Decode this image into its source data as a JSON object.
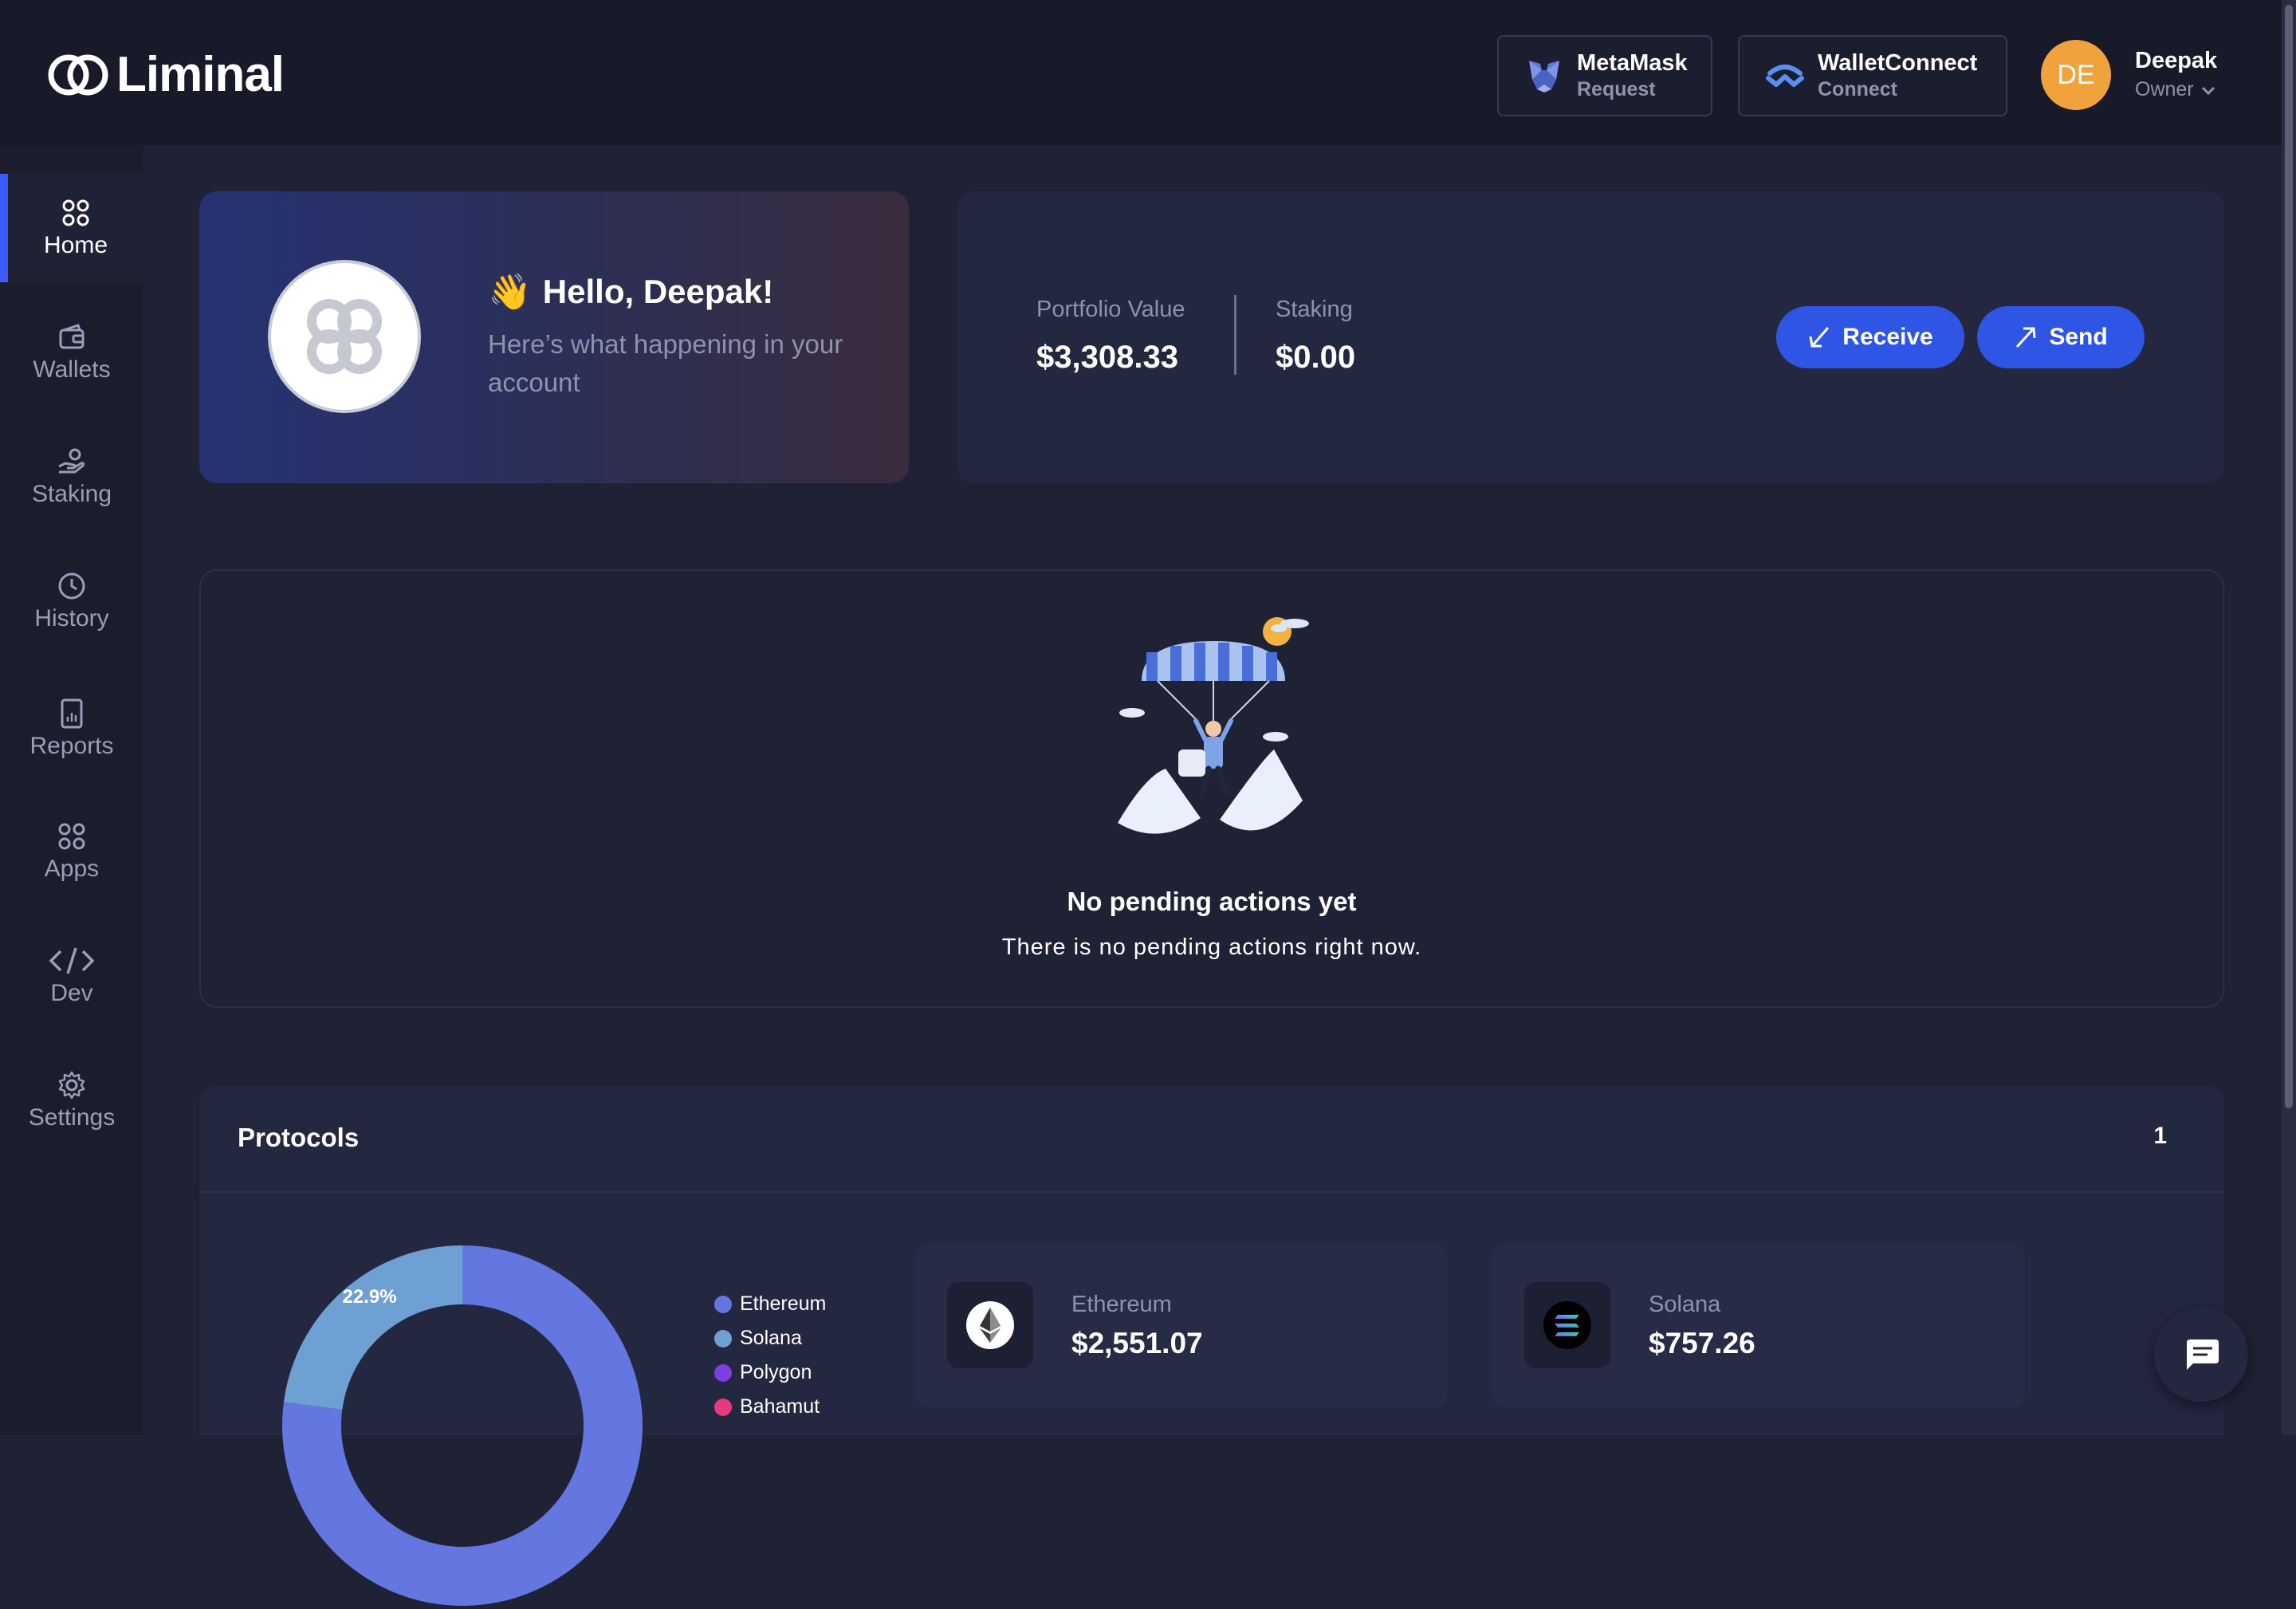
{
  "app": {
    "name": "Liminal"
  },
  "topbar": {
    "metamask": {
      "name": "MetaMask",
      "sub": "Request"
    },
    "walletconnect": {
      "name": "WalletConnect",
      "sub": "Connect"
    },
    "user": {
      "initials": "DE",
      "name": "Deepak",
      "role": "Owner"
    }
  },
  "sidebar": {
    "items": [
      {
        "label": "Home",
        "icon": "grid-icon",
        "active": true
      },
      {
        "label": "Wallets",
        "icon": "wallet-icon"
      },
      {
        "label": "Staking",
        "icon": "staking-hand-icon"
      },
      {
        "label": "History",
        "icon": "clock-icon"
      },
      {
        "label": "Reports",
        "icon": "report-chart-icon"
      },
      {
        "label": "Apps",
        "icon": "apps-grid-icon"
      },
      {
        "label": "Dev",
        "icon": "code-icon"
      },
      {
        "label": "Settings",
        "icon": "gear-icon"
      }
    ]
  },
  "greeting": {
    "wave": "👋",
    "title": "Hello, Deepak!",
    "subtitle": "Here’s what happening in your account"
  },
  "portfolio": {
    "value_label": "Portfolio Value",
    "value": "$3,308.33",
    "staking_label": "Staking",
    "staking_value": "$0.00",
    "receive_label": "Receive",
    "send_label": "Send"
  },
  "pending": {
    "title": "No pending actions yet",
    "subtitle": "There is no pending actions right now."
  },
  "protocols": {
    "title": "Protocols",
    "count": "1",
    "chart_data": {
      "type": "pie",
      "categories": [
        "Ethereum",
        "Solana",
        "Polygon",
        "Bahamut"
      ],
      "values": [
        77.1,
        22.9,
        0,
        0
      ],
      "data_labels": [
        "",
        "22.9%",
        "",
        ""
      ],
      "colors": [
        "#6476e0",
        "#6fa0d4",
        "#7b3fe4",
        "#e8397a"
      ],
      "legend_position": "right"
    },
    "cards": [
      {
        "name": "Ethereum",
        "value": "$2,551.07",
        "icon": "ethereum-icon"
      },
      {
        "name": "Solana",
        "value": "$757.26",
        "icon": "solana-icon"
      }
    ]
  },
  "colors": {
    "background": "#1f2235",
    "topbar": "#181a2a",
    "accent": "#2f55e4",
    "avatar": "#f0a23c"
  }
}
